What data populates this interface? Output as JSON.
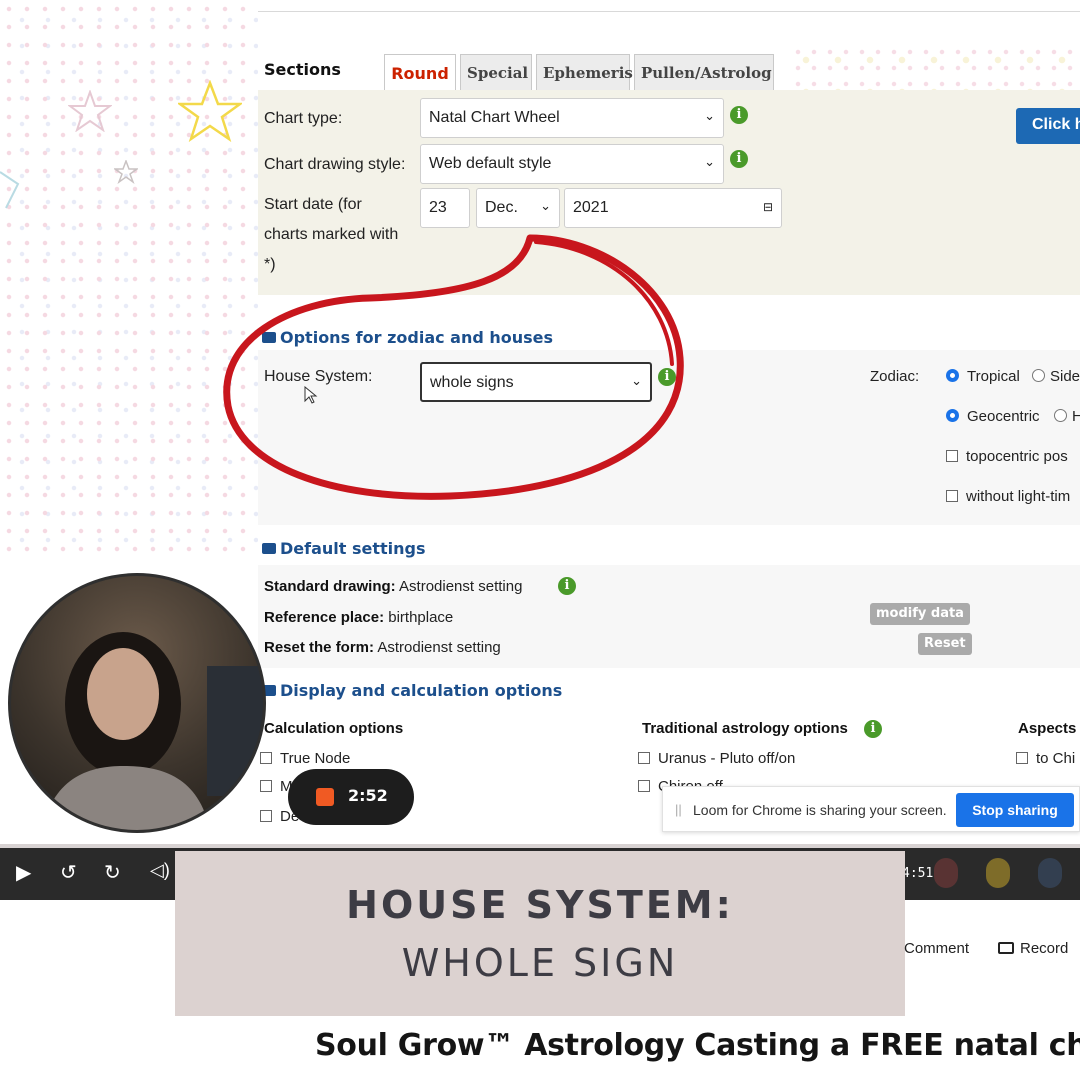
{
  "form": {
    "sections_label": "Sections",
    "tabs": [
      {
        "label": "Round",
        "active": true
      },
      {
        "label": "Special",
        "active": false
      },
      {
        "label": "Ephemeris",
        "active": false
      },
      {
        "label": "Pullen/Astrolog",
        "active": false
      }
    ],
    "chart_type_label": "Chart type:",
    "chart_type_value": "Natal Chart Wheel",
    "drawing_style_label": "Chart drawing style:",
    "drawing_style_value": "Web default style",
    "start_date_label_1": "Start date (for",
    "start_date_label_2": "charts marked with",
    "start_date_label_3": "*)",
    "start_day": "23",
    "start_month": "Dec.",
    "start_year": "2021",
    "click_button_label": "Click h",
    "zodiac_section_title": "Options for zodiac and houses",
    "house_system_label": "House System:",
    "house_system_value": "whole signs",
    "zodiac_label": "Zodiac:",
    "zodiac_tropical": "Tropical",
    "zodiac_sidereal": "Side",
    "geocentric": "Geocentric",
    "helio": "H",
    "topocentric": "topocentric pos",
    "light_time": "without light-tim",
    "defaults_title": "Default settings",
    "standard_drawing_label": "Standard drawing:",
    "standard_drawing_value": "Astrodienst setting",
    "reference_place_label": "Reference place:",
    "reference_place_value": "birthplace",
    "reset_form_label": "Reset the form:",
    "reset_form_value": "Astrodienst setting",
    "modify_data_button": "modify data",
    "reset_button": "Reset",
    "display_title": "Display and calculation options",
    "calc_options_head": "Calculation options",
    "traditional_head": "Traditional astrology options",
    "aspects_head": "Aspects",
    "true_node": "True Node",
    "calc_row2": "M",
    "calc_row3": "De",
    "uranus_pluto": "Uranus - Pluto off/on",
    "trad_row2": "Chiron off",
    "to_chiron": "to Chi"
  },
  "loom": {
    "message": "Loom for Chrome is sharing your screen.",
    "stop_label": "Stop sharing"
  },
  "recording": {
    "time": "2:52"
  },
  "player": {
    "duration": "4:51"
  },
  "caption": {
    "title": "HOUSE SYSTEM:",
    "subtitle": "WHOLE SIGN"
  },
  "actions": {
    "comment": "Comment",
    "record": "Record"
  },
  "video_title": "Soul Grow™ Astrology Casting a FREE natal chart",
  "colors": {
    "accent_blue": "#1d69b4",
    "tab_active": "#cc2200",
    "annotation_red": "#c8161d",
    "caption_bg": "#dcd2d0",
    "rec_orange": "#f05a23"
  }
}
